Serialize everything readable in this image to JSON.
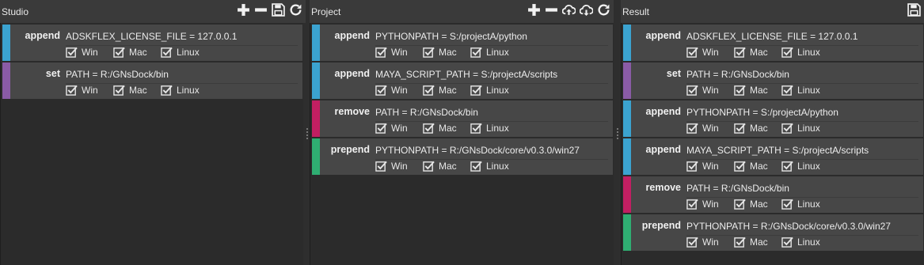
{
  "colors": {
    "append": "#3ba3d0",
    "set": "#8a5ba6",
    "remove": "#c21f62",
    "prepend": "#2fae72"
  },
  "panels": [
    {
      "title": "Studio",
      "tools": [
        "plus-icon",
        "minus-icon",
        "save-icon",
        "refresh-icon"
      ],
      "items": [
        {
          "action": "append",
          "expr": "ADSKFLEX_LICENSE_FILE = 127.0.0.1",
          "platforms": [
            "Win",
            "Mac",
            "Linux"
          ]
        },
        {
          "action": "set",
          "expr": "PATH = R:/GNsDock/bin",
          "platforms": [
            "Win",
            "Mac",
            "Linux"
          ]
        }
      ]
    },
    {
      "title": "Project",
      "tools": [
        "plus-icon",
        "minus-icon",
        "cloud-upload-icon",
        "cloud-download-icon",
        "refresh-icon"
      ],
      "items": [
        {
          "action": "append",
          "expr": "PYTHONPATH = S:/projectA/python",
          "platforms": [
            "Win",
            "Mac",
            "Linux"
          ]
        },
        {
          "action": "append",
          "expr": "MAYA_SCRIPT_PATH = S:/projectA/scripts",
          "platforms": [
            "Win",
            "Mac",
            "Linux"
          ]
        },
        {
          "action": "remove",
          "expr": "PATH = R:/GNsDock/bin",
          "platforms": [
            "Win",
            "Mac",
            "Linux"
          ]
        },
        {
          "action": "prepend",
          "expr": "PYTHONPATH = R:/GNsDock/core/v0.3.0/win27",
          "platforms": [
            "Win",
            "Mac",
            "Linux"
          ]
        }
      ]
    },
    {
      "title": "Result",
      "tools": [
        "save-icon"
      ],
      "items": [
        {
          "action": "append",
          "expr": "ADSKFLEX_LICENSE_FILE = 127.0.0.1",
          "platforms": [
            "Win",
            "Mac",
            "Linux"
          ]
        },
        {
          "action": "set",
          "expr": "PATH = R:/GNsDock/bin",
          "platforms": [
            "Win",
            "Mac",
            "Linux"
          ]
        },
        {
          "action": "append",
          "expr": "PYTHONPATH = S:/projectA/python",
          "platforms": [
            "Win",
            "Mac",
            "Linux"
          ]
        },
        {
          "action": "append",
          "expr": "MAYA_SCRIPT_PATH = S:/projectA/scripts",
          "platforms": [
            "Win",
            "Mac",
            "Linux"
          ]
        },
        {
          "action": "remove",
          "expr": "PATH = R:/GNsDock/bin",
          "platforms": [
            "Win",
            "Mac",
            "Linux"
          ]
        },
        {
          "action": "prepend",
          "expr": "PYTHONPATH = R:/GNsDock/core/v0.3.0/win27",
          "platforms": [
            "Win",
            "Mac",
            "Linux"
          ]
        }
      ]
    }
  ]
}
